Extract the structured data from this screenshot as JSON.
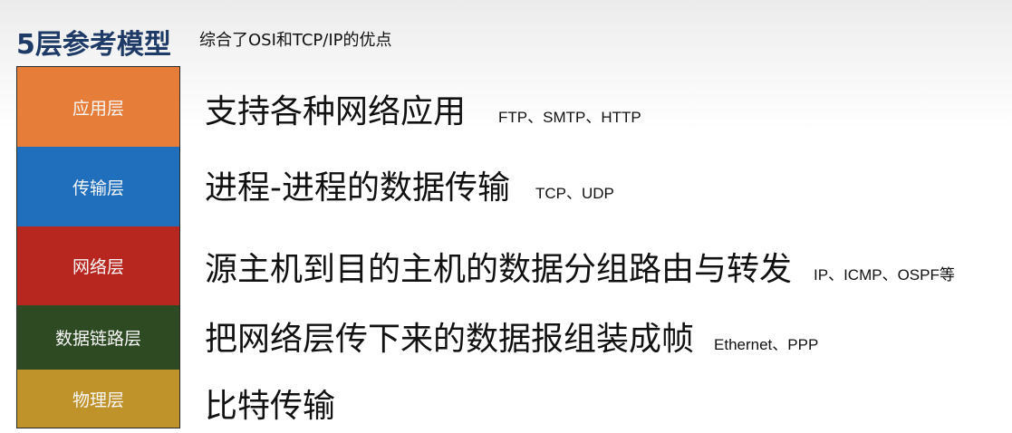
{
  "title": {
    "main": "5层参考模型",
    "subtitle": "综合了OSI和TCP/IP的优点"
  },
  "layers": [
    {
      "name": "应用层",
      "description": "支持各种网络应用",
      "protocols": "FTP、SMTP、HTTP",
      "color": "#e67d39"
    },
    {
      "name": "传输层",
      "description": "进程-进程的数据传输",
      "protocols": "TCP、UDP",
      "color": "#1f6fbd"
    },
    {
      "name": "网络层",
      "description": "源主机到目的主机的数据分组路由与转发",
      "protocols": "IP、ICMP、OSPF等",
      "color": "#b8271f"
    },
    {
      "name": "数据链路层",
      "description": "把网络层传下来的数据报组装成帧",
      "protocols": "Ethernet、PPP",
      "color": "#2e4a23"
    },
    {
      "name": "物理层",
      "description": "比特传输",
      "protocols": "",
      "color": "#c0922a"
    }
  ]
}
